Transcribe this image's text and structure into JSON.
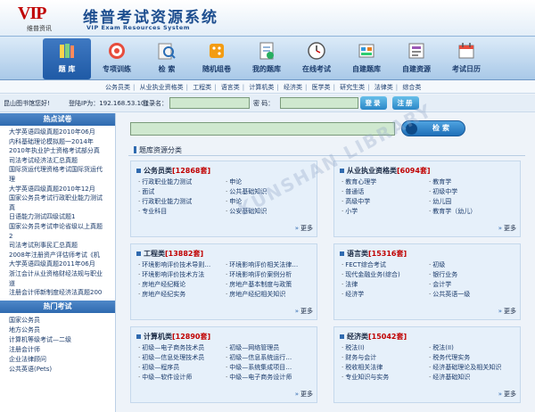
{
  "header": {
    "logo_mark": "VIP",
    "logo_sub": "维普资讯",
    "title": "维普考试资源系统",
    "subtitle": "VIP Exam Resources System"
  },
  "nav": [
    {
      "label": "题  库",
      "icon": "library-icon"
    },
    {
      "label": "专项训练",
      "icon": "target-icon"
    },
    {
      "label": "检  索",
      "icon": "search-icon"
    },
    {
      "label": "随机组卷",
      "icon": "dice-icon"
    },
    {
      "label": "我的题库",
      "icon": "my-library-icon"
    },
    {
      "label": "在线考试",
      "icon": "clock-icon"
    },
    {
      "label": "自建题库",
      "icon": "build-library-icon"
    },
    {
      "label": "自建资源",
      "icon": "build-resource-icon"
    },
    {
      "label": "考试日历",
      "icon": "calendar-icon"
    }
  ],
  "subnav": [
    "公务员类",
    "从业执业资格类",
    "工程类",
    "语言类",
    "计算机类",
    "经济类",
    "医学类",
    "研究生类",
    "法律类",
    "综合类"
  ],
  "login": {
    "org": "昆山图书馆您好!",
    "ip": "登陆IP为：192.168.53.101",
    "user_label": "登录名：",
    "pass_label": "密  码：",
    "login_btn": "登录",
    "register_btn": "注册"
  },
  "sidebar": {
    "hot_title": "热点试卷",
    "hot_items": [
      "大学英语四级真题2010年06月",
      "内科基础理论模拟题一2014年",
      "2010年执业护士资格考试部分真",
      "司法考试经济法汇总真题",
      "国际货运代理资格考试国际货运代",
      "理",
      "大学英语四级真题2010年12月",
      "国家公务员考试行政职业能力测试",
      "真",
      "日语能力测试四级试题1",
      "国家公务员考试申论省级以上真题",
      "2",
      "司法考试刑事民汇总真题",
      "2008年注册资产评估师考试《机",
      "大学英语四级真题2011年06月",
      "浙江会计从业资格财经法规与职业",
      "道",
      "注册会计师新制度经济法真题200"
    ],
    "hot_exam_title": "热门考试",
    "hot_exams": [
      "国家公务员",
      "地方公务员",
      "计算机等级考试—二级",
      "注册会计师",
      "企业法律顾问",
      "公共英语(Pets)"
    ]
  },
  "main": {
    "search_btn": "检索",
    "category_title": "题库资源分类",
    "more": "更多",
    "panels": [
      {
        "name": "公务员类",
        "count": "[12868套]",
        "items": [
          "行政职业能力测试",
          "申论",
          "面试",
          "公共基础知识",
          "行政职业能力测试",
          "申论",
          "专业科目",
          "公安基础知识"
        ]
      },
      {
        "name": "从业执业资格类",
        "count": "[6094套]",
        "items": [
          "教育心理学",
          "教育学",
          "普通话",
          "初级中学",
          "高级中学",
          "幼儿园",
          "小学",
          "教育学（幼儿）"
        ]
      },
      {
        "name": "工程类",
        "count": "[13882套]",
        "items": [
          "环境影响评价技术导则…",
          "环境影响评价相关法律…",
          "环境影响评价技术方法",
          "环境影响评价案例分析",
          "房地产经纪概论",
          "房地产基本制度与政策",
          "房地产经纪实务",
          "房地产经纪相关知识"
        ]
      },
      {
        "name": "语言类",
        "count": "[15316套]",
        "items": [
          "FECT综合考试",
          "初级",
          "现代金融业务(综合)",
          "银行业务",
          "法律",
          "会计学",
          "经济学",
          "公共英语一级"
        ]
      },
      {
        "name": "计算机类",
        "count": "[12890套]",
        "items": [
          "初级—电子商务技术员",
          "初级—网络管理员",
          "初级—信息处理技术员",
          "初级—信息系统运行…",
          "初级—程序员",
          "中级—系统集成项目…",
          "中级—软件设计师",
          "中级—电子商务设计师"
        ]
      },
      {
        "name": "经济类",
        "count": "[15042套]",
        "items": [
          "税法(I)",
          "税法(II)",
          "财务与会计",
          "税务代理实务",
          "税收相关法律",
          "经济基础理论及相关知识",
          "专业知识与实务",
          "经济基础知识"
        ]
      }
    ]
  },
  "watermark": "KUNSHAN LIBRARY"
}
